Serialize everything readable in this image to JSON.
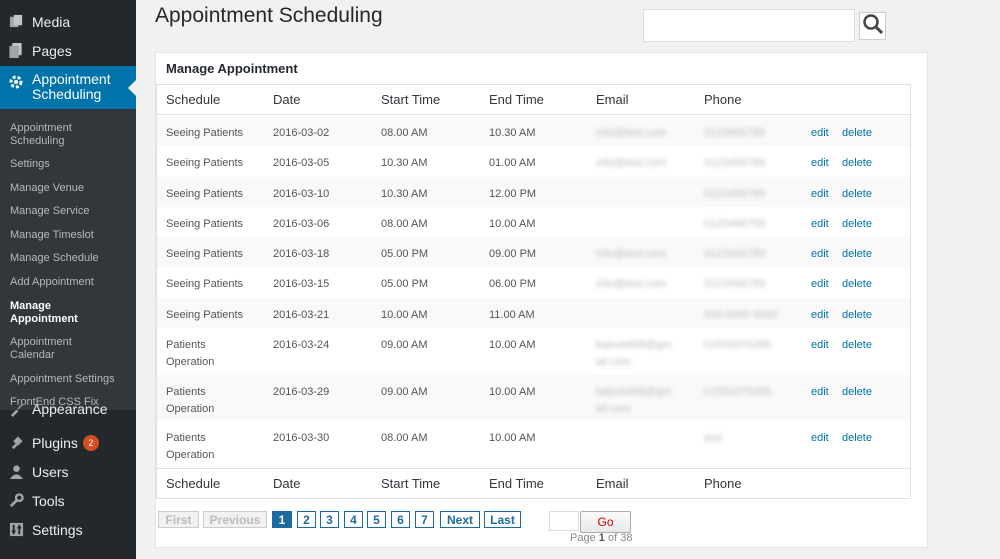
{
  "sidebar": {
    "top_items": [
      {
        "label": "Media",
        "icon": "media-icon"
      },
      {
        "label": "Pages",
        "icon": "pages-icon"
      }
    ],
    "current_item": {
      "label": "Appointment Scheduling",
      "icon": "gear-icon"
    },
    "submenu": [
      "Appointment Scheduling",
      "Settings",
      "Manage Venue",
      "Manage Service",
      "Manage Timeslot",
      "Manage Schedule",
      "Add Appointment",
      "Manage Appointment",
      "Appointment Calendar",
      "Appointment Settings",
      "FrontEnd CSS Fix"
    ],
    "bottom_items": [
      {
        "label": "Appearance",
        "icon": "appearance-icon"
      },
      {
        "label": "Plugins",
        "icon": "plugins-icon",
        "badge": "2"
      },
      {
        "label": "Users",
        "icon": "users-icon"
      },
      {
        "label": "Tools",
        "icon": "tools-icon"
      },
      {
        "label": "Settings",
        "icon": "settings-icon"
      }
    ]
  },
  "page": {
    "title": "Appointment Scheduling",
    "search_placeholder": ""
  },
  "panel": {
    "title": "Manage Appointment",
    "columns": [
      "Schedule",
      "Date",
      "Start Time",
      "End Time",
      "Email",
      "Phone"
    ],
    "actions": {
      "edit": "edit",
      "delete": "delete"
    },
    "rows": [
      {
        "schedule": "Seeing Patients",
        "date": "2016-03-02",
        "start": "08.00 AM",
        "end": "10.30 AM",
        "email": "info@test.com",
        "phone": "0123456789"
      },
      {
        "schedule": "Seeing Patients",
        "date": "2016-03-05",
        "start": "10.30 AM",
        "end": "01.00 AM",
        "email": "info@test.com",
        "phone": "0123456789"
      },
      {
        "schedule": "Seeing Patients",
        "date": "2016-03-10",
        "start": "10.30 AM",
        "end": "12.00 PM",
        "email": "",
        "phone": "0123456789"
      },
      {
        "schedule": "Seeing Patients",
        "date": "2016-03-06",
        "start": "08.00 AM",
        "end": "10.00 AM",
        "email": "",
        "phone": "0123456789"
      },
      {
        "schedule": "Seeing Patients",
        "date": "2016-03-18",
        "start": "05.00 PM",
        "end": "09.00 PM",
        "email": "info@test.com",
        "phone": "0123456789"
      },
      {
        "schedule": "Seeing Patients",
        "date": "2016-03-15",
        "start": "05.00 PM",
        "end": "06.00 PM",
        "email": "info@test.com",
        "phone": "0123456789"
      },
      {
        "schedule": "Seeing Patients",
        "date": "2016-03-21",
        "start": "10.00 AM",
        "end": "11.00 AM",
        "email": "",
        "phone": "000 0000 0000"
      },
      {
        "schedule": "Patients\nOperation",
        "date": "2016-03-24",
        "start": "09.00 AM",
        "end": "10.00 AM",
        "email": "babubd08@gm\nail.com",
        "phone": "01553376395"
      },
      {
        "schedule": "Patients\nOperation",
        "date": "2016-03-29",
        "start": "09.00 AM",
        "end": "10.00 AM",
        "email": "babubd08@gm\nail.com",
        "phone": "01553376395"
      },
      {
        "schedule": "Patients\nOperation",
        "date": "2016-03-30",
        "start": "08.00 AM",
        "end": "10.00 AM",
        "email": "",
        "phone": "asd"
      }
    ]
  },
  "pagination": {
    "first": "First",
    "previous": "Previous",
    "pages": [
      "1",
      "2",
      "3",
      "4",
      "5",
      "6",
      "7"
    ],
    "current_page": "1",
    "next": "Next",
    "last": "Last",
    "go": "Go",
    "info_prefix": "Page",
    "info_current": "1",
    "info_of": "of",
    "info_total": "38"
  },
  "colors": {
    "sidebar_bg": "#23282d",
    "accent": "#0073aa",
    "badge": "#d54e21"
  }
}
